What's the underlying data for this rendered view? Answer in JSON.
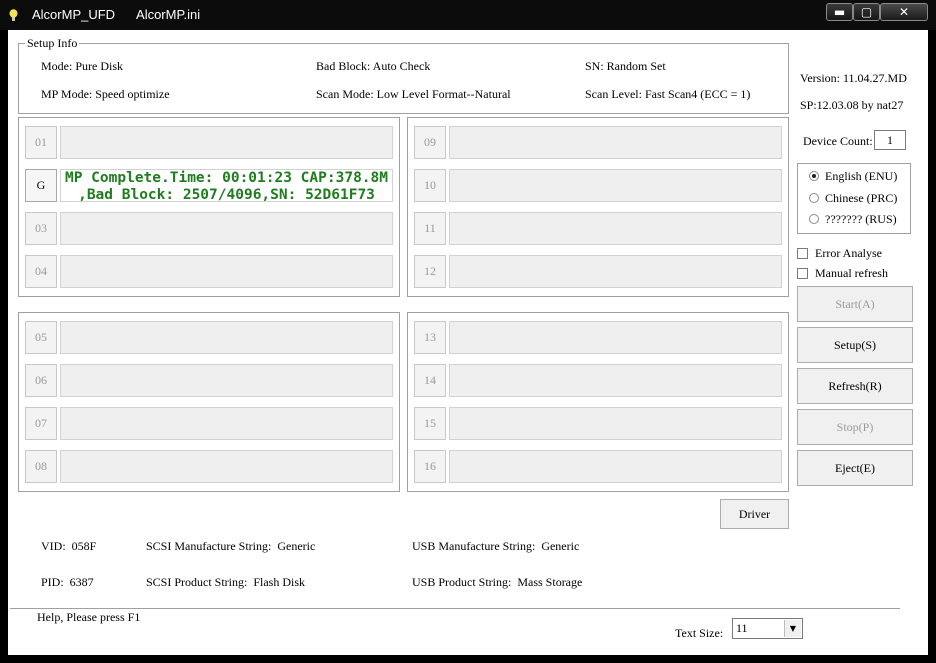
{
  "window": {
    "title": "AlcorMP_UFD      AlcorMP.ini",
    "minimize": "▬",
    "maximize": "▢",
    "close": "✕"
  },
  "setup_info": {
    "legend": "Setup Info",
    "mode": "Mode: Pure Disk",
    "bad_block": "Bad Block: Auto Check",
    "sn": "SN: Random Set",
    "mp_mode": "MP Mode: Speed optimize",
    "scan_mode": "Scan Mode: Low Level Format--Natural",
    "scan_level": "Scan Level: Fast Scan4 (ECC = 1)"
  },
  "version": "Version: 11.04.27.MD",
  "sp": "SP:12.03.08 by nat27",
  "device_count": {
    "label": "Device Count:",
    "value": "1"
  },
  "languages": [
    {
      "label": "English (ENU)",
      "selected": true
    },
    {
      "label": "Chinese (PRC)",
      "selected": false
    },
    {
      "label": "??????? (RUS)",
      "selected": false
    }
  ],
  "options": {
    "error_analyse": "Error Analyse",
    "manual_refresh": "Manual refresh"
  },
  "buttons": {
    "start": "Start(A)",
    "setup": "Setup(S)",
    "refresh": "Refresh(R)",
    "stop": "Stop(P)",
    "eject": "Eject(E)",
    "driver": "Driver"
  },
  "slots": [
    {
      "label": "01"
    },
    {
      "label": "G",
      "line1": "MP Complete.Time: 00:01:23 CAP:378.8M",
      "line2": ",Bad Block: 2507/4096,SN: 52D61F73"
    },
    {
      "label": "03"
    },
    {
      "label": "04"
    },
    {
      "label": "05"
    },
    {
      "label": "06"
    },
    {
      "label": "07"
    },
    {
      "label": "08"
    },
    {
      "label": "09"
    },
    {
      "label": "10"
    },
    {
      "label": "11"
    },
    {
      "label": "12"
    },
    {
      "label": "13"
    },
    {
      "label": "14"
    },
    {
      "label": "15"
    },
    {
      "label": "16"
    }
  ],
  "device_info": {
    "vid": "VID:  058F",
    "pid": "PID:  6387",
    "scsi_manufacture": "SCSI Manufacture String:  Generic",
    "scsi_product": "SCSI Product String:  Flash Disk",
    "usb_manufacture": "USB Manufacture String:  Generic",
    "usb_product": "USB Product String:  Mass Storage"
  },
  "status": {
    "help": "Help, Please press F1",
    "text_size_label": "Text Size:",
    "text_size_value": "11"
  }
}
